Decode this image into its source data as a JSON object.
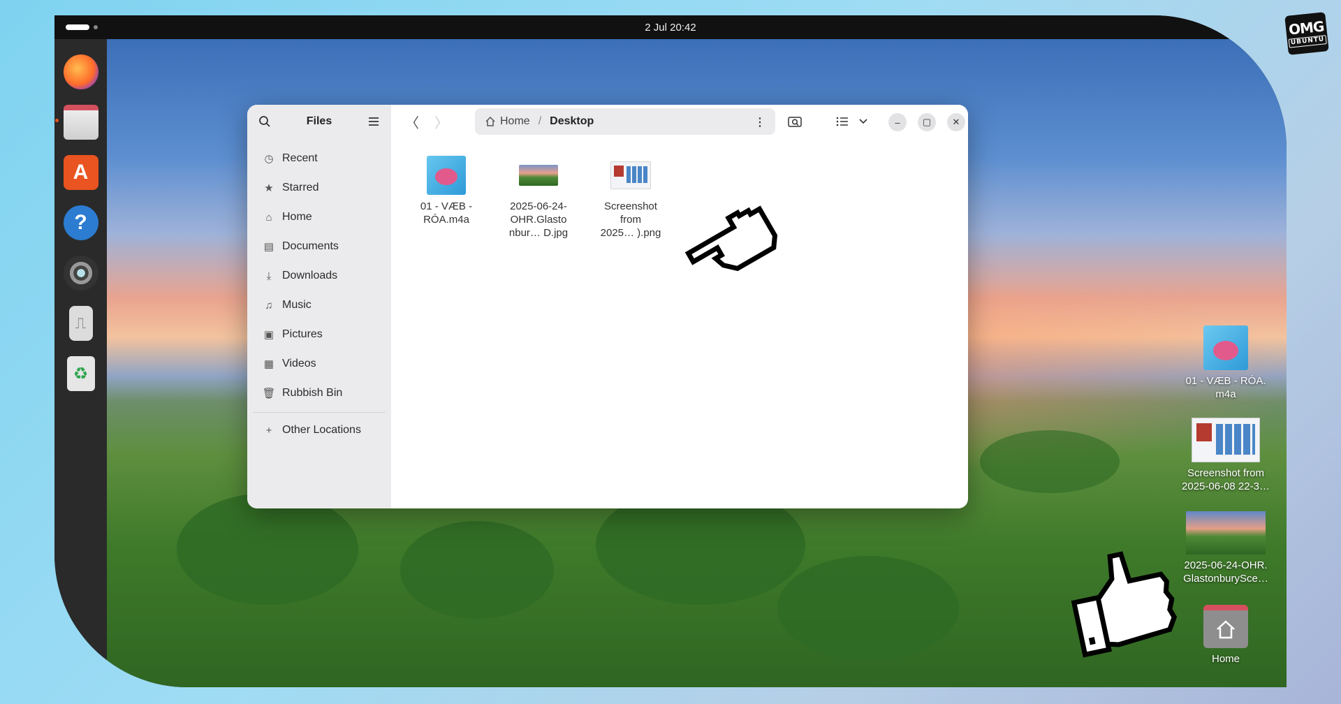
{
  "brand": {
    "line1": "OMG",
    "line2": "UBUNTU"
  },
  "topbar": {
    "datetime": "2 Jul  20:42"
  },
  "dock": {
    "items": [
      {
        "name": "Firefox",
        "icon": "firefox-icon"
      },
      {
        "name": "Files",
        "icon": "files-icon",
        "running": true
      },
      {
        "name": "App Center",
        "icon": "app-center-icon"
      },
      {
        "name": "Help",
        "icon": "help-icon"
      },
      {
        "name": "Music",
        "icon": "music-player-icon"
      },
      {
        "name": "USB",
        "icon": "usb-drive-icon"
      },
      {
        "name": "Rubbish Bin",
        "icon": "recycle-bin-icon"
      }
    ]
  },
  "files_window": {
    "title": "Files",
    "sidebar": {
      "items": [
        {
          "label": "Recent",
          "icon": "clock-icon"
        },
        {
          "label": "Starred",
          "icon": "star-icon"
        },
        {
          "label": "Home",
          "icon": "home-icon"
        },
        {
          "label": "Documents",
          "icon": "document-icon"
        },
        {
          "label": "Downloads",
          "icon": "download-icon"
        },
        {
          "label": "Music",
          "icon": "music-note-icon"
        },
        {
          "label": "Pictures",
          "icon": "picture-icon"
        },
        {
          "label": "Videos",
          "icon": "film-icon"
        },
        {
          "label": "Rubbish Bin",
          "icon": "trash-icon"
        }
      ],
      "other_locations": "Other Locations"
    },
    "path": {
      "home": "Home",
      "separator": "/",
      "current": "Desktop"
    },
    "files": [
      {
        "name": "01 - VÆB - RÓA.m4a",
        "line1": "01 - VÆB -",
        "line2": "RÓA.m4a",
        "line3": ""
      },
      {
        "name": "2025-06-24-OHR.Glastonbury… D.jpg",
        "line1": "2025-06-24-",
        "line2": "OHR.Glasto",
        "line3": "nbur… D.jpg"
      },
      {
        "name": "Screenshot from 2025… ).png",
        "line1": "Screenshot",
        "line2": "from",
        "line3": "2025… ).png"
      }
    ]
  },
  "desktop_icons": [
    {
      "line1": "01 - VÆB - RÓA.",
      "line2": "m4a"
    },
    {
      "line1": "Screenshot from",
      "line2": "2025-06-08 22-3…"
    },
    {
      "line1": "2025-06-24-OHR.",
      "line2": "GlastonburySce…"
    },
    {
      "line1": "Home",
      "line2": ""
    }
  ],
  "colors": {
    "accent": "#e95420",
    "window_bg": "#ffffff",
    "sidebar_bg": "#ebebed",
    "topbar_bg": "#111111"
  }
}
